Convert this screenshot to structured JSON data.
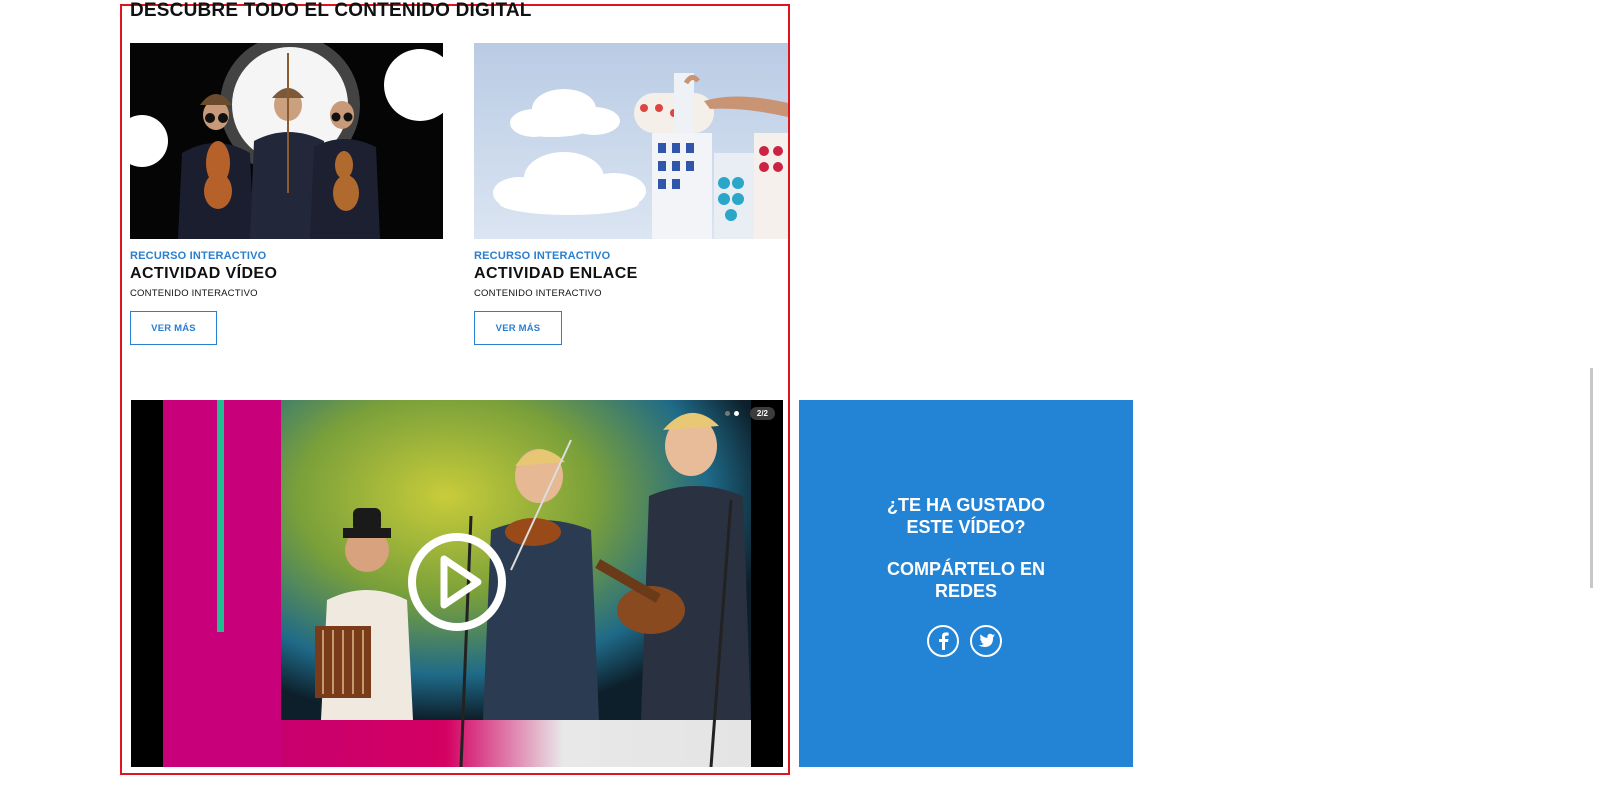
{
  "section": {
    "heading": "DESCUBRE TODO EL CONTENIDO DIGITAL"
  },
  "cards": [
    {
      "kind": "RECURSO INTERACTIVO",
      "title": "ACTIVIDAD VÍDEO",
      "subtitle": "CONTENIDO INTERACTIVO",
      "button": "VER MÁS",
      "image": "musicians-with-violins-photo"
    },
    {
      "kind": "RECURSO INTERACTIVO",
      "title": "ACTIVIDAD ENLACE",
      "subtitle": "CONTENIDO INTERACTIVO",
      "button": "VER MÁS",
      "image": "paper-cutout-buildings-clouds-photo"
    }
  ],
  "video": {
    "counter": "2/2",
    "image": "folk-band-on-stage-photo",
    "play_icon": "play-icon"
  },
  "share": {
    "question_line1": "¿TE HA GUSTADO",
    "question_line2": "ESTE VÍDEO?",
    "cta_line1": "COMPÁRTELO EN",
    "cta_line2": "REDES",
    "bg_color": "#2384d6",
    "icons": [
      "facebook-icon",
      "twitter-icon"
    ]
  },
  "colors": {
    "accent": "#2a7fd0",
    "highlight_border": "#e0141e"
  }
}
